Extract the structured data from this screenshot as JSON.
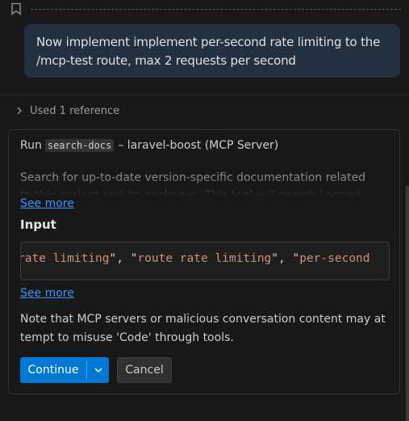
{
  "message": {
    "text": "Now implement implement per-second rate limiting to the /mcp-test route, max 2 requests per second"
  },
  "references": {
    "label": "Used 1 reference"
  },
  "tool_card": {
    "run_prefix": "Run",
    "tool_name": "search-docs",
    "server_text": "– laravel-boost (MCP Server)",
    "description": "Search for up-to-date version-specific documentation related to this project and its packages. This tool will search Laravel hosted documentation based on the packages installed.",
    "see_more_label": "See more",
    "input_label": "Input",
    "input_items": [
      "rate limiting",
      "route rate limiting",
      "per-second"
    ],
    "see_more_label_2": "See more",
    "note": "Note that MCP servers or malicious conversation content may attempt to misuse 'Code' through tools.",
    "continue_label": "Continue",
    "cancel_label": "Cancel"
  },
  "icons": {
    "bookmark": "bookmark-icon",
    "chevron_right": "chevron-right-icon",
    "chevron_down": "chevron-down-icon"
  },
  "colors": {
    "accent": "#0078d4",
    "link": "#3794ff",
    "string": "#ce9178",
    "bubble": "#233040"
  }
}
